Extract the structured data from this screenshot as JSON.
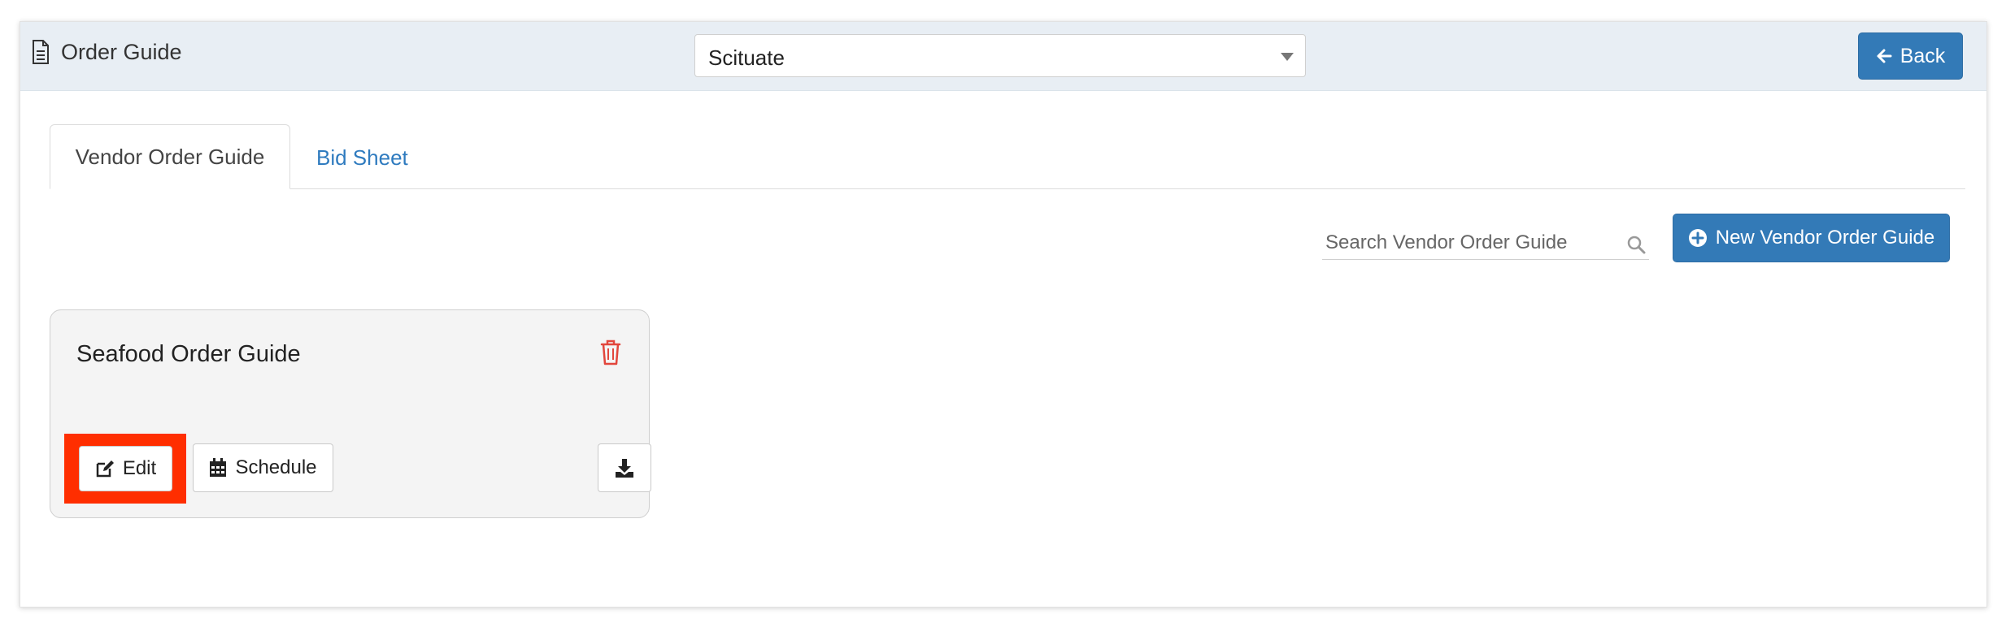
{
  "header": {
    "title": "Order Guide",
    "title_icon": "document-icon",
    "location_select": {
      "value": "Scituate"
    },
    "back_button": {
      "label": "Back",
      "icon": "arrow-left-icon"
    }
  },
  "tabs": [
    {
      "label": "Vendor Order Guide",
      "active": true
    },
    {
      "label": "Bid Sheet",
      "active": false
    }
  ],
  "toolbar": {
    "search": {
      "placeholder": "Search Vendor Order Guide",
      "value": "",
      "icon": "search-icon"
    },
    "new_button": {
      "label": "New Vendor Order Guide",
      "icon": "plus-circle-icon"
    }
  },
  "cards": [
    {
      "title": "Seafood Order Guide",
      "delete_icon": "trash-icon",
      "edit_label": "Edit",
      "schedule_label": "Schedule",
      "download_icon": "download-icon"
    }
  ],
  "colors": {
    "primary": "#337ab7",
    "header_bg": "#e8eef4",
    "link": "#2f7bbf",
    "danger": "#e2463c",
    "highlight": "#ff2e00"
  }
}
